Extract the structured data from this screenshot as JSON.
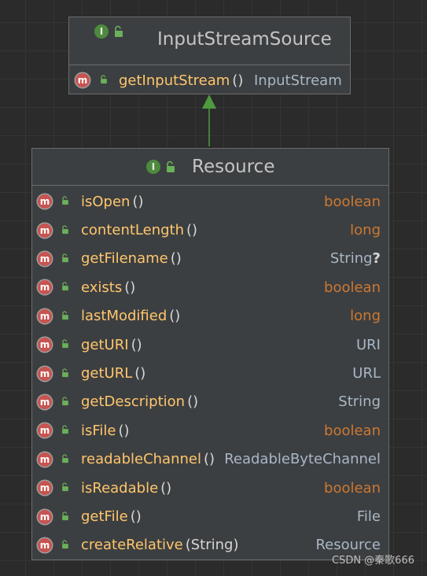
{
  "parent_interface": {
    "kind_icon": "I",
    "title": "InputStreamSource",
    "methods": [
      {
        "icon": "m",
        "name": "getInputStream",
        "params": "()",
        "return_type": "InputStream",
        "type_kind": "ref"
      }
    ]
  },
  "child_interface": {
    "kind_icon": "I",
    "title": "Resource",
    "methods": [
      {
        "icon": "m",
        "name": "isOpen",
        "params": "()",
        "return_type": "boolean",
        "type_kind": "primitive"
      },
      {
        "icon": "m",
        "name": "contentLength",
        "params": "()",
        "return_type": "long",
        "type_kind": "primitive"
      },
      {
        "icon": "m",
        "name": "getFilename",
        "params": "()",
        "return_type": "String",
        "nullable_mark": "?",
        "type_kind": "ref"
      },
      {
        "icon": "m",
        "name": "exists",
        "params": "()",
        "return_type": "boolean",
        "type_kind": "primitive"
      },
      {
        "icon": "m",
        "name": "lastModified",
        "params": "()",
        "return_type": "long",
        "type_kind": "primitive"
      },
      {
        "icon": "m",
        "name": "getURI",
        "params": "()",
        "return_type": "URI",
        "type_kind": "ref"
      },
      {
        "icon": "m",
        "name": "getURL",
        "params": "()",
        "return_type": "URL",
        "type_kind": "ref"
      },
      {
        "icon": "m",
        "name": "getDescription",
        "params": "()",
        "return_type": "String",
        "type_kind": "ref"
      },
      {
        "icon": "m",
        "name": "isFile",
        "params": "()",
        "return_type": "boolean",
        "type_kind": "primitive"
      },
      {
        "icon": "m",
        "name": "readableChannel",
        "params": "()",
        "return_type": "ReadableByteChannel",
        "type_kind": "ref"
      },
      {
        "icon": "m",
        "name": "isReadable",
        "params": "()",
        "return_type": "boolean",
        "type_kind": "primitive"
      },
      {
        "icon": "m",
        "name": "getFile",
        "params": "()",
        "return_type": "File",
        "type_kind": "ref"
      },
      {
        "icon": "m",
        "name": "createRelative",
        "params": "(String)",
        "return_type": "Resource",
        "type_kind": "ref"
      }
    ]
  },
  "relationship": {
    "type": "extends",
    "from": "Resource",
    "to": "InputStreamSource",
    "color": "#4e9a3e"
  },
  "watermark": "CSDN @秦歌666"
}
